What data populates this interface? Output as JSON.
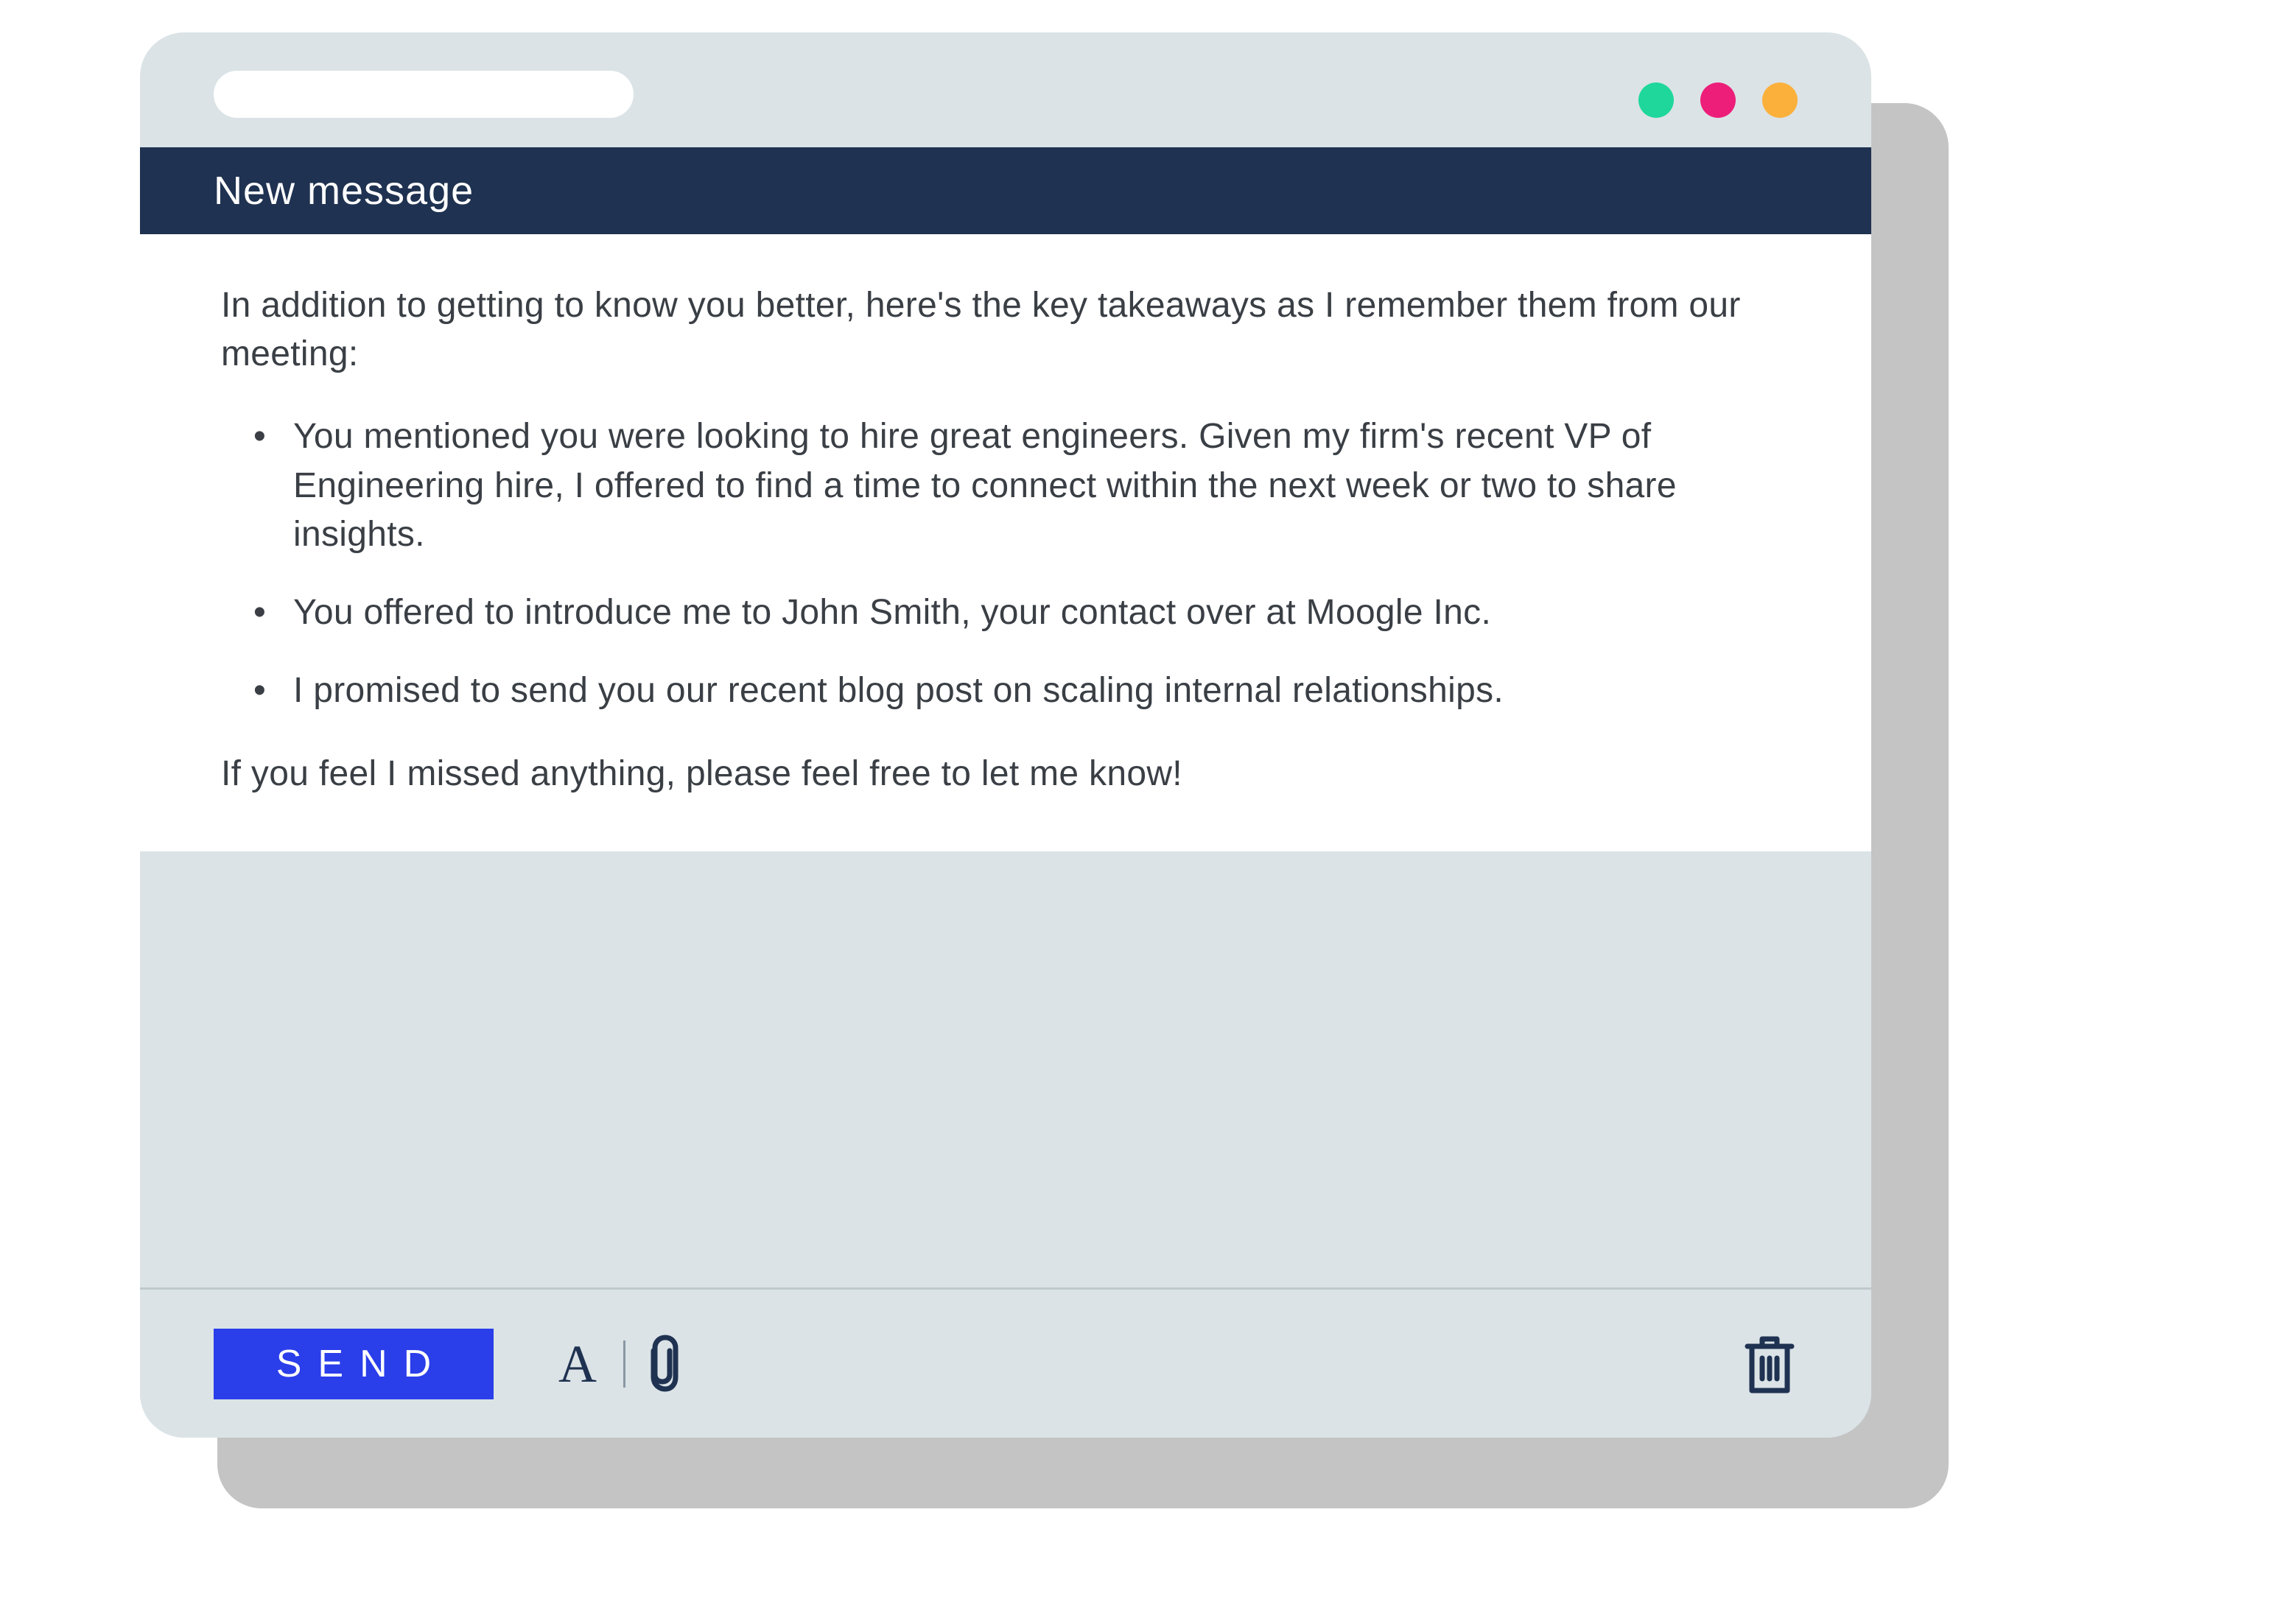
{
  "header": {
    "title": "New message"
  },
  "body": {
    "intro": "In addition to getting to know you better, here's the key takeaways as I remember them from our meeting:",
    "bullets": [
      "You mentioned you were looking to hire great engineers. Given my firm's recent VP of Engineering hire, I offered to find a time to connect within the next week or two to share insights.",
      "You offered to introduce me to John Smith, your contact over at Moogle Inc.",
      "I promised to send you our recent blog post on scaling internal relationships."
    ],
    "outro": "If you feel I missed anything, please feel free to let me know!"
  },
  "toolbar": {
    "send_label": "SEND",
    "format_letter": "A"
  },
  "colors": {
    "header_bg": "#1f3251",
    "send_bg": "#2a3eea",
    "window_bg": "#dbe3e6",
    "shadow": "#c4c4c4",
    "dot_green": "#1fd79b",
    "dot_pink": "#ed1e79",
    "dot_yellow": "#fbb03b"
  }
}
